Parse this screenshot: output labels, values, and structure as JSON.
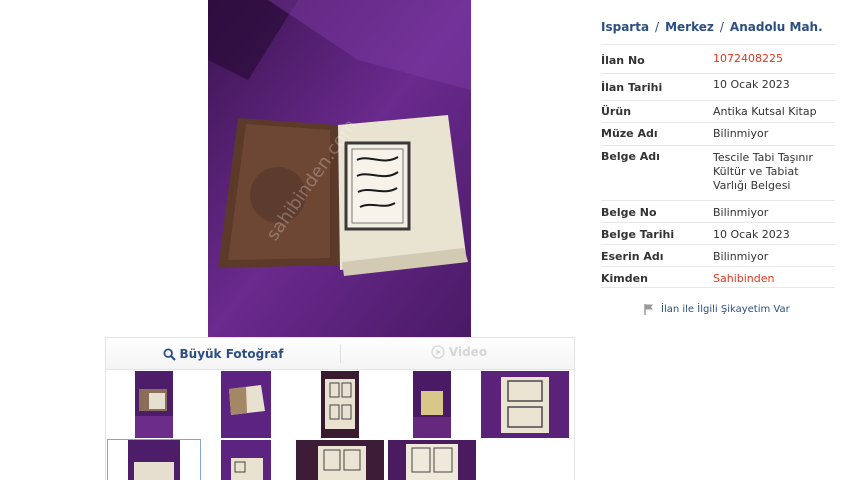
{
  "top_fragment": "1072408225",
  "breadcrumb": {
    "city": "Isparta",
    "district": "Merkez",
    "neighborhood": "Anadolu Mah.",
    "separator": "/"
  },
  "details": [
    {
      "label": "İlan No",
      "value": "1072408225",
      "highlight": true
    },
    {
      "label": "İlan Tarihi",
      "value": "10 Ocak 2023"
    },
    {
      "label": "Ürün",
      "value": "Antika Kutsal Kitap"
    },
    {
      "label": "Müze Adı",
      "value": "Bilinmiyor"
    },
    {
      "label": "Belge Adı",
      "value": "Tescile Tabi Taşınır Kültür ve Tabiat Varlığı Belgesi"
    },
    {
      "label": "Belge No",
      "value": "Bilinmiyor"
    },
    {
      "label": "Belge Tarihi",
      "value": "10 Ocak 2023"
    },
    {
      "label": "Eserin Adı",
      "value": "Bilinmiyor"
    },
    {
      "label": "Kimden",
      "value": "Sahibinden",
      "highlight": true
    }
  ],
  "complaint_label": "İlan ile İlgili Şikayetim Var",
  "tabs": {
    "big_photo": "Büyük Fotoğraf",
    "video": "Video"
  },
  "icons": {
    "search": "magnifier-icon",
    "video": "play-circle-icon",
    "flag": "flag-icon"
  },
  "colors": {
    "link": "#2c4f82",
    "highlight": "#e0371e",
    "background_photo": "#5a2178"
  },
  "thumbnail_count": 9,
  "selected_thumbnail": 6
}
